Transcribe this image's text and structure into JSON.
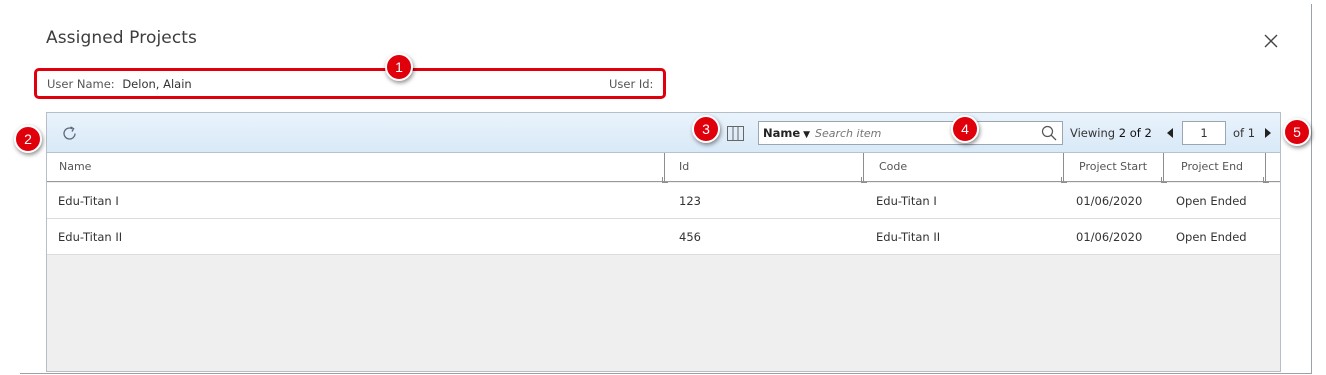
{
  "dialog": {
    "title": "Assigned Projects"
  },
  "user_info": {
    "name_label": "User Name:",
    "name_value": "Delon, Alain",
    "id_label": "User Id:"
  },
  "toolbar": {
    "search_field": "Name",
    "search_placeholder": "Search item",
    "viewing_label": "Viewing",
    "viewing_count": "2 of 2",
    "page_current": "1",
    "page_total": "of 1"
  },
  "table": {
    "columns": [
      "Name",
      "Id",
      "Code",
      "Project Start",
      "Project End"
    ],
    "rows": [
      {
        "name": "Edu-Titan I",
        "id": "123",
        "code": "Edu-Titan I",
        "start": "01/06/2020",
        "end": "Open Ended"
      },
      {
        "name": "Edu-Titan II",
        "id": "456",
        "code": "Edu-Titan II",
        "start": "01/06/2020",
        "end": "Open Ended"
      }
    ]
  },
  "callouts": [
    "1",
    "2",
    "3",
    "4",
    "5"
  ],
  "icons": {
    "close": "close-icon",
    "refresh": "refresh-icon",
    "columns": "columns-icon",
    "search": "search-icon"
  },
  "colors": {
    "callout": "#e0000b",
    "toolbar": "#e3eef9"
  }
}
